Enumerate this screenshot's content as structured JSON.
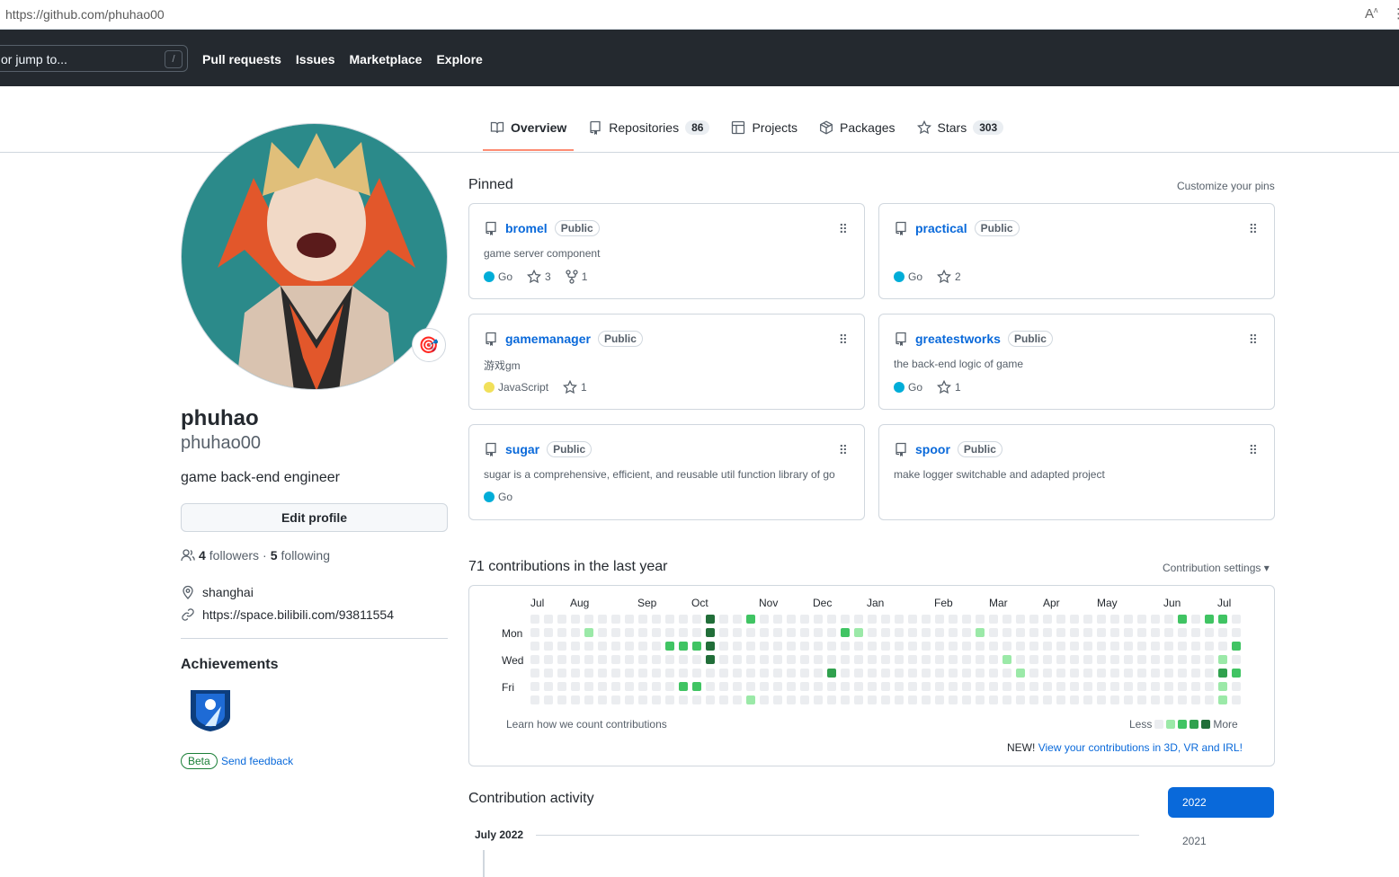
{
  "browser": {
    "url": "https://github.com/phuhao00"
  },
  "header": {
    "search_placeholder": "or jump to...",
    "search_shortcut": "/",
    "nav": [
      "Pull requests",
      "Issues",
      "Marketplace",
      "Explore"
    ]
  },
  "tabs": [
    {
      "label": "Overview",
      "count": null,
      "active": true
    },
    {
      "label": "Repositories",
      "count": "86",
      "active": false
    },
    {
      "label": "Projects",
      "count": null,
      "active": false
    },
    {
      "label": "Packages",
      "count": null,
      "active": false
    },
    {
      "label": "Stars",
      "count": "303",
      "active": false
    }
  ],
  "profile": {
    "name": "phuhao",
    "login": "phuhao00",
    "bio": "game back-end engineer",
    "edit_label": "Edit profile",
    "followers": "4",
    "followers_label": "followers",
    "following": "5",
    "following_label": "following",
    "location": "shanghai",
    "website": "https://space.bilibili.com/93811554",
    "status_emoji": "🎯"
  },
  "achievements": {
    "title": "Achievements",
    "beta_label": "Beta",
    "feedback_label": "Send feedback"
  },
  "pinned": {
    "title": "Pinned",
    "customize_label": "Customize your pins",
    "repos": [
      {
        "name": "bromel",
        "visibility": "Public",
        "description": "game server component",
        "language": "Go",
        "lang_color": "#00ADD8",
        "stars": "3",
        "forks": "1"
      },
      {
        "name": "practical",
        "visibility": "Public",
        "description": "",
        "language": "Go",
        "lang_color": "#00ADD8",
        "stars": "2",
        "forks": null
      },
      {
        "name": "gamemanager",
        "visibility": "Public",
        "description": "游戏gm",
        "language": "JavaScript",
        "lang_color": "#f1e05a",
        "stars": "1",
        "forks": null
      },
      {
        "name": "greatestworks",
        "visibility": "Public",
        "description": "the back-end logic of game",
        "language": "Go",
        "lang_color": "#00ADD8",
        "stars": "1",
        "forks": null
      },
      {
        "name": "sugar",
        "visibility": "Public",
        "description": "sugar is a comprehensive, efficient, and reusable util function library of go",
        "language": "Go",
        "lang_color": "#00ADD8",
        "stars": null,
        "forks": null
      },
      {
        "name": "spoor",
        "visibility": "Public",
        "description": "make logger switchable and adapted project",
        "language": null,
        "lang_color": null,
        "stars": null,
        "forks": null
      }
    ]
  },
  "contributions": {
    "title": "71 contributions in the last year",
    "settings_label": "Contribution settings ▾",
    "months": [
      "Jul",
      "Aug",
      "Sep",
      "Oct",
      "Nov",
      "Dec",
      "Jan",
      "Feb",
      "Mar",
      "Apr",
      "May",
      "Jun",
      "Jul"
    ],
    "day_labels": [
      "Mon",
      "Wed",
      "Fri"
    ],
    "learn_label": "Learn how we count contributions",
    "less_label": "Less",
    "more_label": "More",
    "new_label": "NEW!",
    "new_link": "View your contributions in 3D, VR and IRL!",
    "colors": [
      "#ebedf0",
      "#9be9a8",
      "#40c463",
      "#30a14e",
      "#216e39"
    ],
    "cells": [
      [
        4,
        1,
        1
      ],
      [
        10,
        2,
        2
      ],
      [
        11,
        2,
        2
      ],
      [
        11,
        5,
        2
      ],
      [
        12,
        2,
        2
      ],
      [
        12,
        5,
        2
      ],
      [
        13,
        0,
        4
      ],
      [
        13,
        1,
        4
      ],
      [
        13,
        2,
        4
      ],
      [
        13,
        3,
        4
      ],
      [
        16,
        0,
        2
      ],
      [
        16,
        6,
        1
      ],
      [
        22,
        4,
        3
      ],
      [
        23,
        1,
        2
      ],
      [
        24,
        1,
        1
      ],
      [
        33,
        1,
        1
      ],
      [
        35,
        3,
        1
      ],
      [
        36,
        4,
        1
      ],
      [
        48,
        0,
        2
      ],
      [
        50,
        0,
        2
      ],
      [
        51,
        0,
        2
      ],
      [
        51,
        3,
        1
      ],
      [
        51,
        4,
        3
      ],
      [
        51,
        5,
        1
      ],
      [
        51,
        6,
        1
      ],
      [
        52,
        2,
        2
      ],
      [
        52,
        4,
        2
      ]
    ]
  },
  "activity": {
    "title": "Contribution activity",
    "month": "July 2022",
    "years": [
      "2022",
      "2021"
    ]
  }
}
